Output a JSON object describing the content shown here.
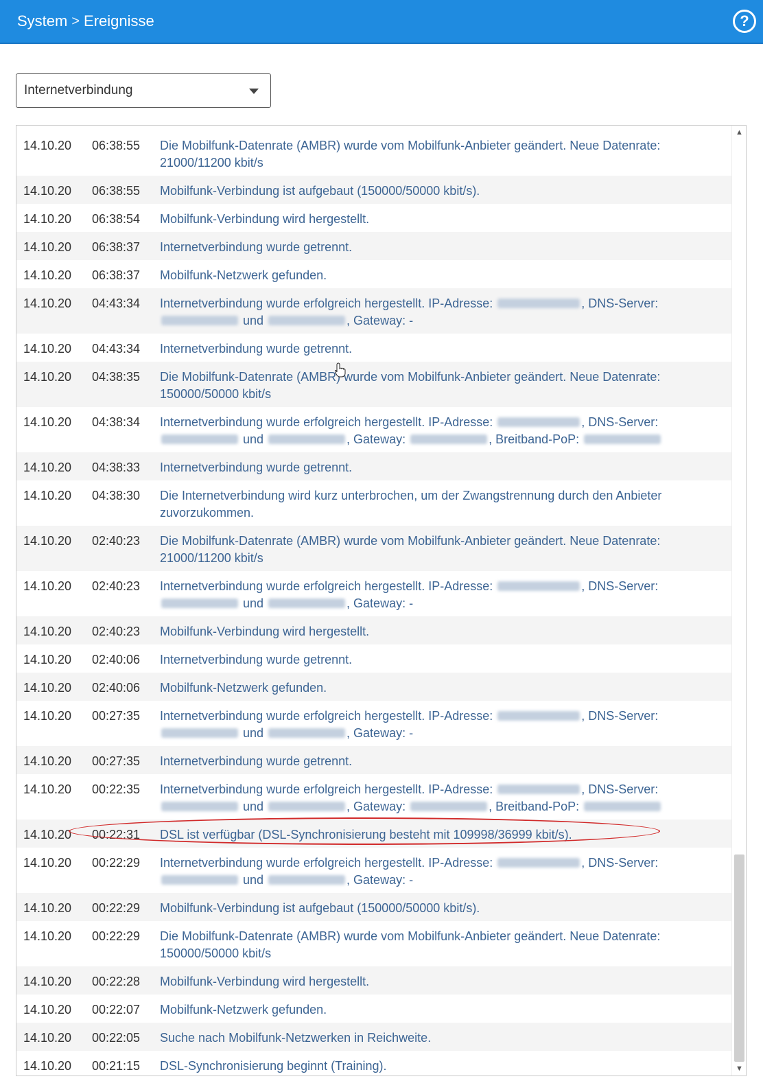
{
  "header": {
    "crumbs": [
      "System",
      "Ereignisse"
    ],
    "separator": ">",
    "help_label": "?"
  },
  "filter": {
    "selected": "Internetverbindung"
  },
  "events": [
    {
      "date": "14.10.20",
      "time": "06:38:55",
      "segments": [
        "Die Mobilfunk-Datenrate (AMBR) wurde vom Mobilfunk-Anbieter geändert. Neue Datenrate: 21000/11200 kbit/s"
      ]
    },
    {
      "date": "14.10.20",
      "time": "06:38:55",
      "segments": [
        "Mobilfunk-Verbindung ist aufgebaut (150000/50000 kbit/s)."
      ]
    },
    {
      "date": "14.10.20",
      "time": "06:38:54",
      "segments": [
        "Mobilfunk-Verbindung wird hergestellt."
      ]
    },
    {
      "date": "14.10.20",
      "time": "06:38:37",
      "segments": [
        "Internetverbindung wurde getrennt."
      ]
    },
    {
      "date": "14.10.20",
      "time": "06:38:37",
      "segments": [
        "Mobilfunk-Netzwerk gefunden."
      ]
    },
    {
      "date": "14.10.20",
      "time": "04:43:34",
      "segments": [
        "Internetverbindung wurde erfolgreich hergestellt. IP-Adresse: ",
        "{BLUR}",
        ", DNS-Server: ",
        "{BLUR}",
        " und ",
        "{BLUR}",
        ", Gateway: -"
      ]
    },
    {
      "date": "14.10.20",
      "time": "04:43:34",
      "segments": [
        "Internetverbindung wurde getrennt."
      ]
    },
    {
      "date": "14.10.20",
      "time": "04:38:35",
      "segments": [
        "Die Mobilfunk-Datenrate (AMBR) wurde vom Mobilfunk-Anbieter geändert. Neue Datenrate: 150000/50000 kbit/s"
      ]
    },
    {
      "date": "14.10.20",
      "time": "04:38:34",
      "segments": [
        "Internetverbindung wurde erfolgreich hergestellt. IP-Adresse: ",
        "{BLUR}",
        ", DNS-Server: ",
        "{BLUR}",
        " und ",
        "{BLUR}",
        ", Gateway: ",
        "{BLUR}",
        ", Breitband-PoP: ",
        "{BLUR}"
      ]
    },
    {
      "date": "14.10.20",
      "time": "04:38:33",
      "segments": [
        "Internetverbindung wurde getrennt."
      ]
    },
    {
      "date": "14.10.20",
      "time": "04:38:30",
      "segments": [
        "Die Internetverbindung wird kurz unterbrochen, um der Zwangstrennung durch den Anbieter zuvorzukommen."
      ]
    },
    {
      "date": "14.10.20",
      "time": "02:40:23",
      "segments": [
        "Die Mobilfunk-Datenrate (AMBR) wurde vom Mobilfunk-Anbieter geändert. Neue Datenrate: 21000/11200 kbit/s"
      ]
    },
    {
      "date": "14.10.20",
      "time": "02:40:23",
      "segments": [
        "Internetverbindung wurde erfolgreich hergestellt. IP-Adresse: ",
        "{BLUR}",
        ", DNS-Server: ",
        "{BLUR}",
        " und ",
        "{BLUR}",
        ", Gateway: -"
      ]
    },
    {
      "date": "14.10.20",
      "time": "02:40:23",
      "segments": [
        "Mobilfunk-Verbindung wird hergestellt."
      ]
    },
    {
      "date": "14.10.20",
      "time": "02:40:06",
      "segments": [
        "Internetverbindung wurde getrennt."
      ]
    },
    {
      "date": "14.10.20",
      "time": "02:40:06",
      "segments": [
        "Mobilfunk-Netzwerk gefunden."
      ]
    },
    {
      "date": "14.10.20",
      "time": "00:27:35",
      "segments": [
        "Internetverbindung wurde erfolgreich hergestellt. IP-Adresse: ",
        "{BLUR}",
        ", DNS-Server: ",
        "{BLUR}",
        " und ",
        "{BLUR}",
        ", Gateway: -"
      ]
    },
    {
      "date": "14.10.20",
      "time": "00:27:35",
      "segments": [
        "Internetverbindung wurde getrennt."
      ]
    },
    {
      "date": "14.10.20",
      "time": "00:22:35",
      "segments": [
        "Internetverbindung wurde erfolgreich hergestellt. IP-Adresse: ",
        "{BLUR}",
        ", DNS-Server: ",
        "{BLUR}",
        " und ",
        "{BLUR}",
        ", Gateway: ",
        "{BLUR}",
        ", Breitband-PoP: ",
        "{BLUR}"
      ]
    },
    {
      "date": "14.10.20",
      "time": "00:22:31",
      "segments": [
        "DSL ist verfügbar (DSL-Synchronisierung besteht mit 109998/36999 kbit/s)."
      ],
      "highlight": true
    },
    {
      "date": "14.10.20",
      "time": "00:22:29",
      "segments": [
        "Internetverbindung wurde erfolgreich hergestellt. IP-Adresse: ",
        "{BLUR}",
        ", DNS-Server: ",
        "{BLUR}",
        " und ",
        "{BLUR}",
        ", Gateway: -"
      ]
    },
    {
      "date": "14.10.20",
      "time": "00:22:29",
      "segments": [
        "Mobilfunk-Verbindung ist aufgebaut (150000/50000 kbit/s)."
      ]
    },
    {
      "date": "14.10.20",
      "time": "00:22:29",
      "segments": [
        "Die Mobilfunk-Datenrate (AMBR) wurde vom Mobilfunk-Anbieter geändert. Neue Datenrate: 150000/50000 kbit/s"
      ]
    },
    {
      "date": "14.10.20",
      "time": "00:22:28",
      "segments": [
        "Mobilfunk-Verbindung wird hergestellt."
      ]
    },
    {
      "date": "14.10.20",
      "time": "00:22:07",
      "segments": [
        "Mobilfunk-Netzwerk gefunden."
      ]
    },
    {
      "date": "14.10.20",
      "time": "00:22:05",
      "segments": [
        "Suche nach Mobilfunk-Netzwerken in Reichweite."
      ]
    },
    {
      "date": "14.10.20",
      "time": "00:21:15",
      "segments": [
        "DSL-Synchronisierung beginnt (Training)."
      ]
    }
  ],
  "colors": {
    "header_bg": "#1f8be0",
    "message_text": "#3d6594",
    "highlight_ellipse": "#d12a2a"
  }
}
